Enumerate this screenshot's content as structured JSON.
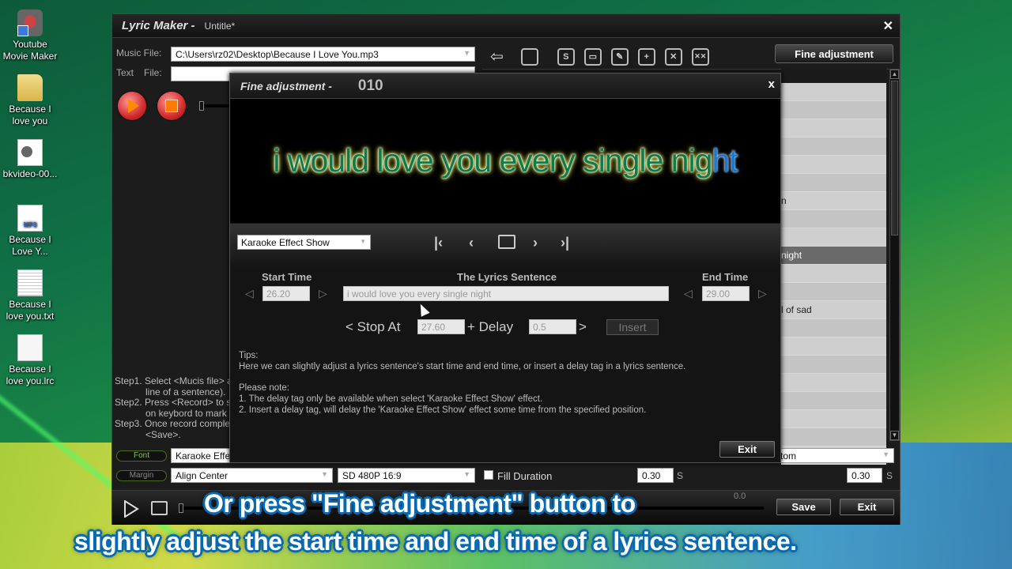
{
  "desktop": {
    "icons": [
      {
        "label": "Youtube Movie Maker",
        "icon": "app-shortcut-icon"
      },
      {
        "label": "Because I love you",
        "icon": "folder-icon"
      },
      {
        "label": "bkvideo-00...",
        "icon": "video-file-icon"
      },
      {
        "label": "Because I Love Y...",
        "icon": "mp3-file-icon"
      },
      {
        "label": "Because I love you.txt",
        "icon": "text-file-icon"
      },
      {
        "label": "Because I love you.lrc",
        "icon": "lrc-file-icon"
      }
    ]
  },
  "main_window": {
    "app_title": "Lyric Maker -",
    "doc_title": "Untitle*",
    "close_glyph": "✕",
    "music_file_label": "Music File:",
    "music_file_value": "C:\\Users\\rz02\\Desktop\\Because I Love You.mp3",
    "text_file_label_1": "Text",
    "text_file_label_2": "File:",
    "text_file_value": "",
    "steps": [
      "Step1. Select <Mucis file> a",
      "line of a sentence).",
      "Step2. Press <Record> to s",
      "on keybord to mark",
      "Step3. Once record comple",
      "<Save>."
    ],
    "toolbar": {
      "back_glyph": "⇦",
      "icons": [
        "folder-icon",
        "save-lrc-icon",
        "window-icon",
        "edit-icon",
        "add-icon",
        "delete-icon",
        "delete-all-icon"
      ],
      "icon_glyphs": [
        "",
        "S",
        "▭",
        "✎",
        "+",
        "✕",
        "✕✕"
      ],
      "fine_adjustment_label": "Fine adjustment"
    },
    "list_rows": [
      "",
      "",
      "",
      "",
      "",
      "",
      "n",
      "",
      "",
      "night",
      "",
      "",
      "l of sad",
      "",
      "",
      "",
      "",
      "",
      "",
      "",
      ""
    ],
    "selected_row": 9,
    "font_pill": "Font",
    "margin_pill": "Margin",
    "font_value": "Karaoke Effe",
    "align_value": "Align Center",
    "resolution_value": "SD 480P 16:9",
    "fill_duration_label": "Fill Duration",
    "fill_duration_value": "0.30",
    "seconds_unit": "S",
    "position_value": "tom",
    "right_duration_value": "0.30",
    "time_readout": "0.0",
    "save_label": "Save",
    "exit_label": "Exit"
  },
  "fine_dialog": {
    "title": "Fine adjustment -",
    "number": "010",
    "close_glyph": "x",
    "preview_sung": "i would love you every single nig",
    "preview_rest": "ht",
    "effect_select": "Karaoke Effect Show",
    "nav": {
      "first": "|‹",
      "prev": "‹",
      "next": "›",
      "last": "›|"
    },
    "start_time_label": "Start Time",
    "lyrics_label": "The Lyrics Sentence",
    "end_time_label": "End Time",
    "start_time_value": "26.20",
    "lyrics_value": "i would love you every single night",
    "end_time_value": "29.00",
    "stop_at_label": "< Stop At",
    "stop_at_value": "27.60",
    "delay_label": "+ Delay",
    "delay_value": "0.5",
    "delay_close": ">",
    "insert_label": "Insert",
    "tips_title": "Tips:",
    "tips_body": "Here we can slightly adjust a lyrics sentence's start time and end time, or insert a delay tag in a lyrics sentence.",
    "note_title": "Please note:",
    "note_1": "1. The delay tag only be available when select 'Karaoke Effect Show' effect.",
    "note_2": "2. Insert a delay tag, will delay the 'Karaoke Effect Show' effect some time from the specified position.",
    "exit_label": "Exit"
  },
  "captions": {
    "line1": "Or press \"Fine adjustment\" button to",
    "line2": "slightly adjust the start time and end time of a lyrics sentence."
  }
}
